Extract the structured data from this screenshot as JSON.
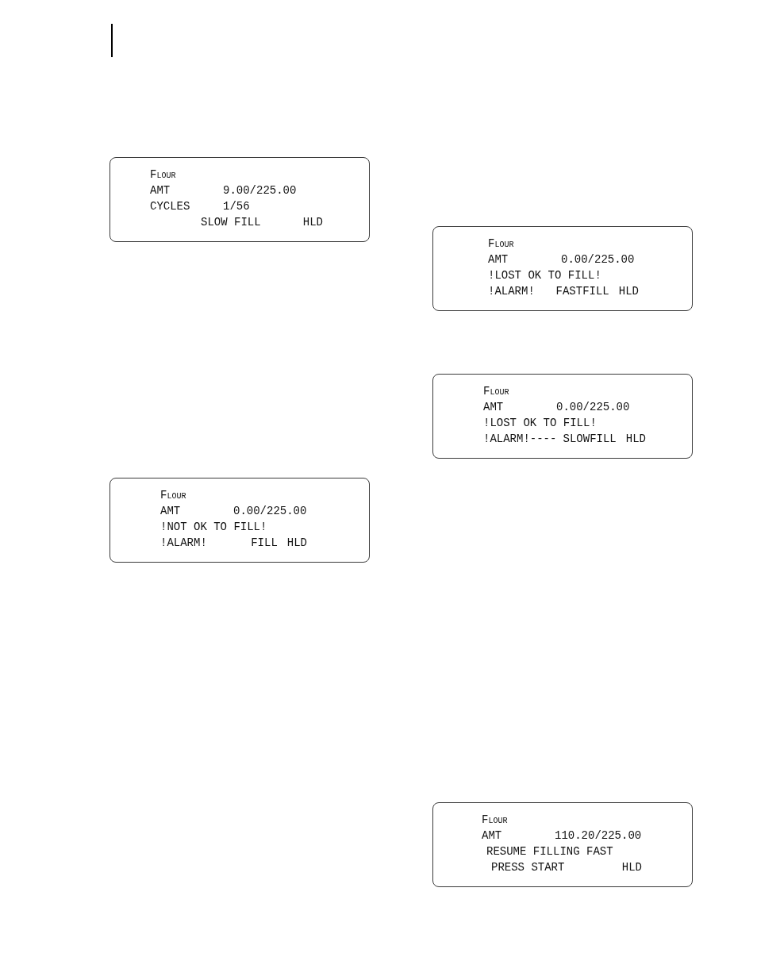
{
  "displays": [
    {
      "title": "Flour",
      "amount": {
        "label": "AMT",
        "value": "9.00/225.00"
      },
      "line_3": {
        "kind": "field",
        "label": "CYCLES",
        "value": "1/56"
      },
      "status": {
        "mode": "SLOW FILL",
        "hold": "HLD"
      }
    },
    {
      "title": "Flour",
      "amount": {
        "label": "AMT",
        "value": "0.00/225.00"
      },
      "line_3": {
        "kind": "message",
        "text": "!LOST OK TO FILL!"
      },
      "status": {
        "alarm": "!ALARM!",
        "mode": "FASTFILL",
        "hold": "HLD"
      }
    },
    {
      "title": "Flour",
      "amount": {
        "label": "AMT",
        "value": "0.00/225.00"
      },
      "line_3": {
        "kind": "message",
        "text": "!LOST OK TO FILL!"
      },
      "status": {
        "alarm": "!ALARM!----",
        "mode": "SLOWFILL",
        "hold": "HLD"
      }
    },
    {
      "title": "Flour",
      "amount": {
        "label": "AMT",
        "value": "0.00/225.00"
      },
      "line_3": {
        "kind": "message",
        "text": "!NOT OK TO FILL!"
      },
      "status": {
        "alarm": "!ALARM!",
        "mode": "FILL",
        "hold": "HLD"
      }
    },
    {
      "title": "Flour",
      "amount": {
        "label": "AMT",
        "value": "110.20/225.00"
      },
      "line_3": {
        "kind": "message",
        "text": "RESUME FILLING FAST"
      },
      "status": {
        "mode": "PRESS START",
        "hold": "HLD"
      }
    }
  ]
}
